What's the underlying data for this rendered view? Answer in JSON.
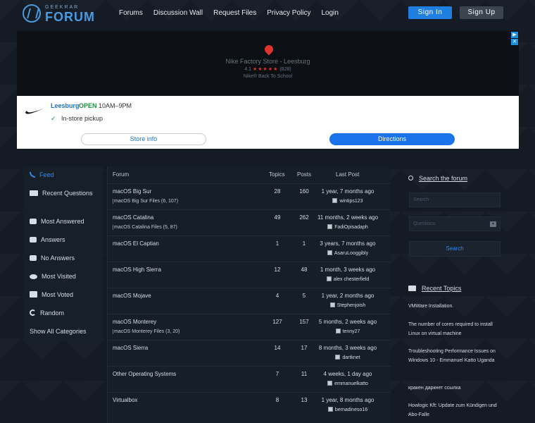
{
  "header": {
    "logo_small": "GEEKRAR",
    "logo_big": "FORUM",
    "nav": [
      "Forums",
      "Discussion Wall",
      "Request Files",
      "Privacy Policy",
      "Login"
    ],
    "signin": "Sign In",
    "signup": "Sign Up"
  },
  "ad": {
    "store": "Nike Factory Store - Leesburg",
    "rating": "4.1",
    "stars": "★★★★★",
    "count": "(828)",
    "tagline": "Nike® Back To School",
    "city": "Leesburg",
    "open": "OPEN",
    "hours": "10AM–9PM",
    "pickup": "In-store pickup",
    "btn_info": "Store info",
    "btn_directions": "Directions"
  },
  "sidebar": {
    "items": [
      {
        "label": "Feed",
        "icon": "rss-icon",
        "active": true
      },
      {
        "label": "Recent Questions",
        "icon": "book-icon"
      },
      {
        "label": "Most Answered",
        "icon": "chat-icon"
      },
      {
        "label": "Answers",
        "icon": "comment-icon"
      },
      {
        "label": "No Answers",
        "icon": "comment-off-icon"
      },
      {
        "label": "Most Visited",
        "icon": "eye-icon"
      },
      {
        "label": "Most Voted",
        "icon": "vote-icon"
      },
      {
        "label": "Random",
        "icon": "random-icon"
      },
      {
        "label": "Show All Categories",
        "icon": ""
      }
    ]
  },
  "table": {
    "headers": {
      "forum": "Forum",
      "topics": "Topics",
      "posts": "Posts",
      "last_post": "Last Post"
    },
    "rows": [
      {
        "name": "macOS Big Sur",
        "sub": "macOS Big Sur Files (6, 107)",
        "topics": "28",
        "posts": "160",
        "when": "1 year, 7 months ago",
        "user": "wintips123"
      },
      {
        "name": "macOS Catalina",
        "sub": "macOS Catalina Files (5, 87)",
        "topics": "49",
        "posts": "262",
        "when": "11 months, 2 weeks ago",
        "user": "FadiOpisadaph"
      },
      {
        "name": "macOS El Captian",
        "sub": "",
        "topics": "1",
        "posts": "1",
        "when": "3 years, 7 months ago",
        "user": "AsaruLooggibly"
      },
      {
        "name": "macOS High Sierra",
        "sub": "",
        "topics": "12",
        "posts": "48",
        "when": "1 month, 3 weeks ago",
        "user": "alex chesterfield"
      },
      {
        "name": "macOS Mojave",
        "sub": "",
        "topics": "4",
        "posts": "5",
        "when": "1 year, 2 months ago",
        "user": "Stephenjoish"
      },
      {
        "name": "macOS Monterey",
        "sub": "macOS Monterey Files (3, 20)",
        "topics": "127",
        "posts": "157",
        "when": "5 months, 2 weeks ago",
        "user": "tenny27"
      },
      {
        "name": "macOS Sierra",
        "sub": "",
        "topics": "14",
        "posts": "17",
        "when": "8 months, 3 weeks ago",
        "user": "dartknet"
      },
      {
        "name": "Other Operating Systems",
        "sub": "",
        "topics": "7",
        "posts": "11",
        "when": "4 weeks, 1 day ago",
        "user": "emmanuelkatto"
      },
      {
        "name": "Virtualbox",
        "sub": "",
        "topics": "8",
        "posts": "13",
        "when": "1 year, 8 months ago",
        "user": "bernadineso16"
      }
    ]
  },
  "right": {
    "search_title": "Search the forum",
    "search_placeholder": "Search",
    "select_value": "Questions",
    "search_button": "Search",
    "recent_title": "Recent Topics",
    "topics": [
      "VMWare Installation.",
      "The number of cores required to install Linux on virtual machine",
      "Troubleshooting Performance Issues on Windows 10 - Emmanuel Katto Uganda",
      "кракен даркнет ссылка",
      "Howlogic Kft: Update zum Kündigen und Abo-Falle"
    ]
  },
  "colors": {
    "accent": "#2e8bef",
    "signin": "#1f7fe0",
    "background": "#141b24"
  }
}
